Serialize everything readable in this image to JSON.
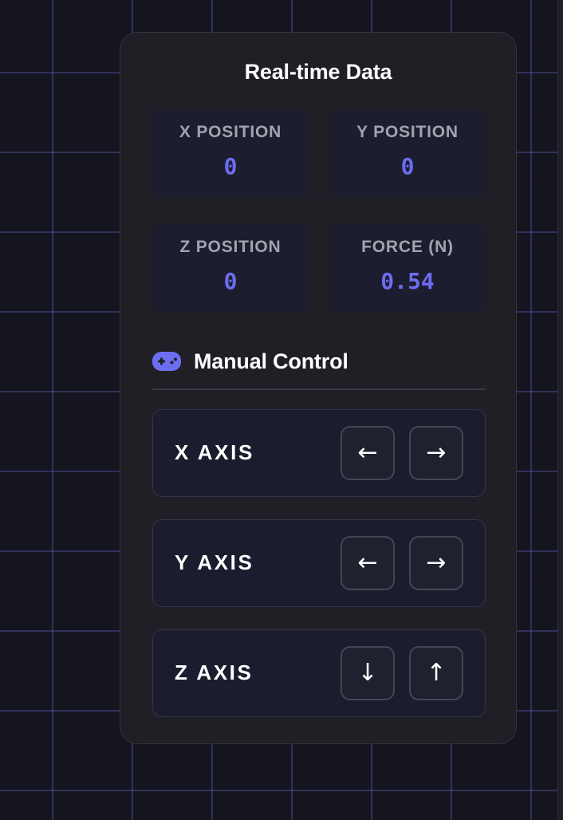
{
  "realtime": {
    "title": "Real-time Data",
    "stats": [
      {
        "label": "X POSITION",
        "value": "0"
      },
      {
        "label": "Y POSITION",
        "value": "0"
      },
      {
        "label": "Z POSITION",
        "value": "0"
      },
      {
        "label": "FORCE (N)",
        "value": "0.54"
      }
    ]
  },
  "manual": {
    "icon": "gamepad-icon",
    "title": "Manual Control",
    "axes": [
      {
        "label": "X AXIS",
        "decrease": "←",
        "increase": "→",
        "decrease_icon": "arrow-left-icon",
        "increase_icon": "arrow-right-icon"
      },
      {
        "label": "Y AXIS",
        "decrease": "←",
        "increase": "→",
        "decrease_icon": "arrow-left-icon",
        "increase_icon": "arrow-right-icon"
      },
      {
        "label": "Z AXIS",
        "decrease": "↓",
        "increase": "↑",
        "decrease_icon": "arrow-down-icon",
        "increase_icon": "arrow-up-icon"
      }
    ]
  },
  "colors": {
    "accent": "#6c6df0",
    "panel": "#1f1f25",
    "card": "#1c1d2e",
    "grid": "#635dbe"
  }
}
